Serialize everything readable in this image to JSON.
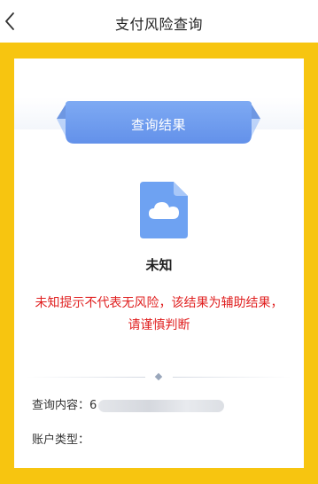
{
  "nav": {
    "title": "支付风险查询",
    "back_icon": "chevron-left-icon"
  },
  "result": {
    "ribbon_label": "查询结果",
    "status_icon": "cloud-file-icon",
    "status": "未知",
    "notice": "未知提示不代表无风险，该结果为辅助结果，请谨慎判断"
  },
  "details": {
    "query_content_label": "查询内容：",
    "query_content_value": "6",
    "account_type_label": "账户类型："
  },
  "colors": {
    "frame": "#f7c510",
    "ribbon": "#6f9ff0",
    "icon": "#6ea2f2",
    "notice": "#e02020"
  }
}
